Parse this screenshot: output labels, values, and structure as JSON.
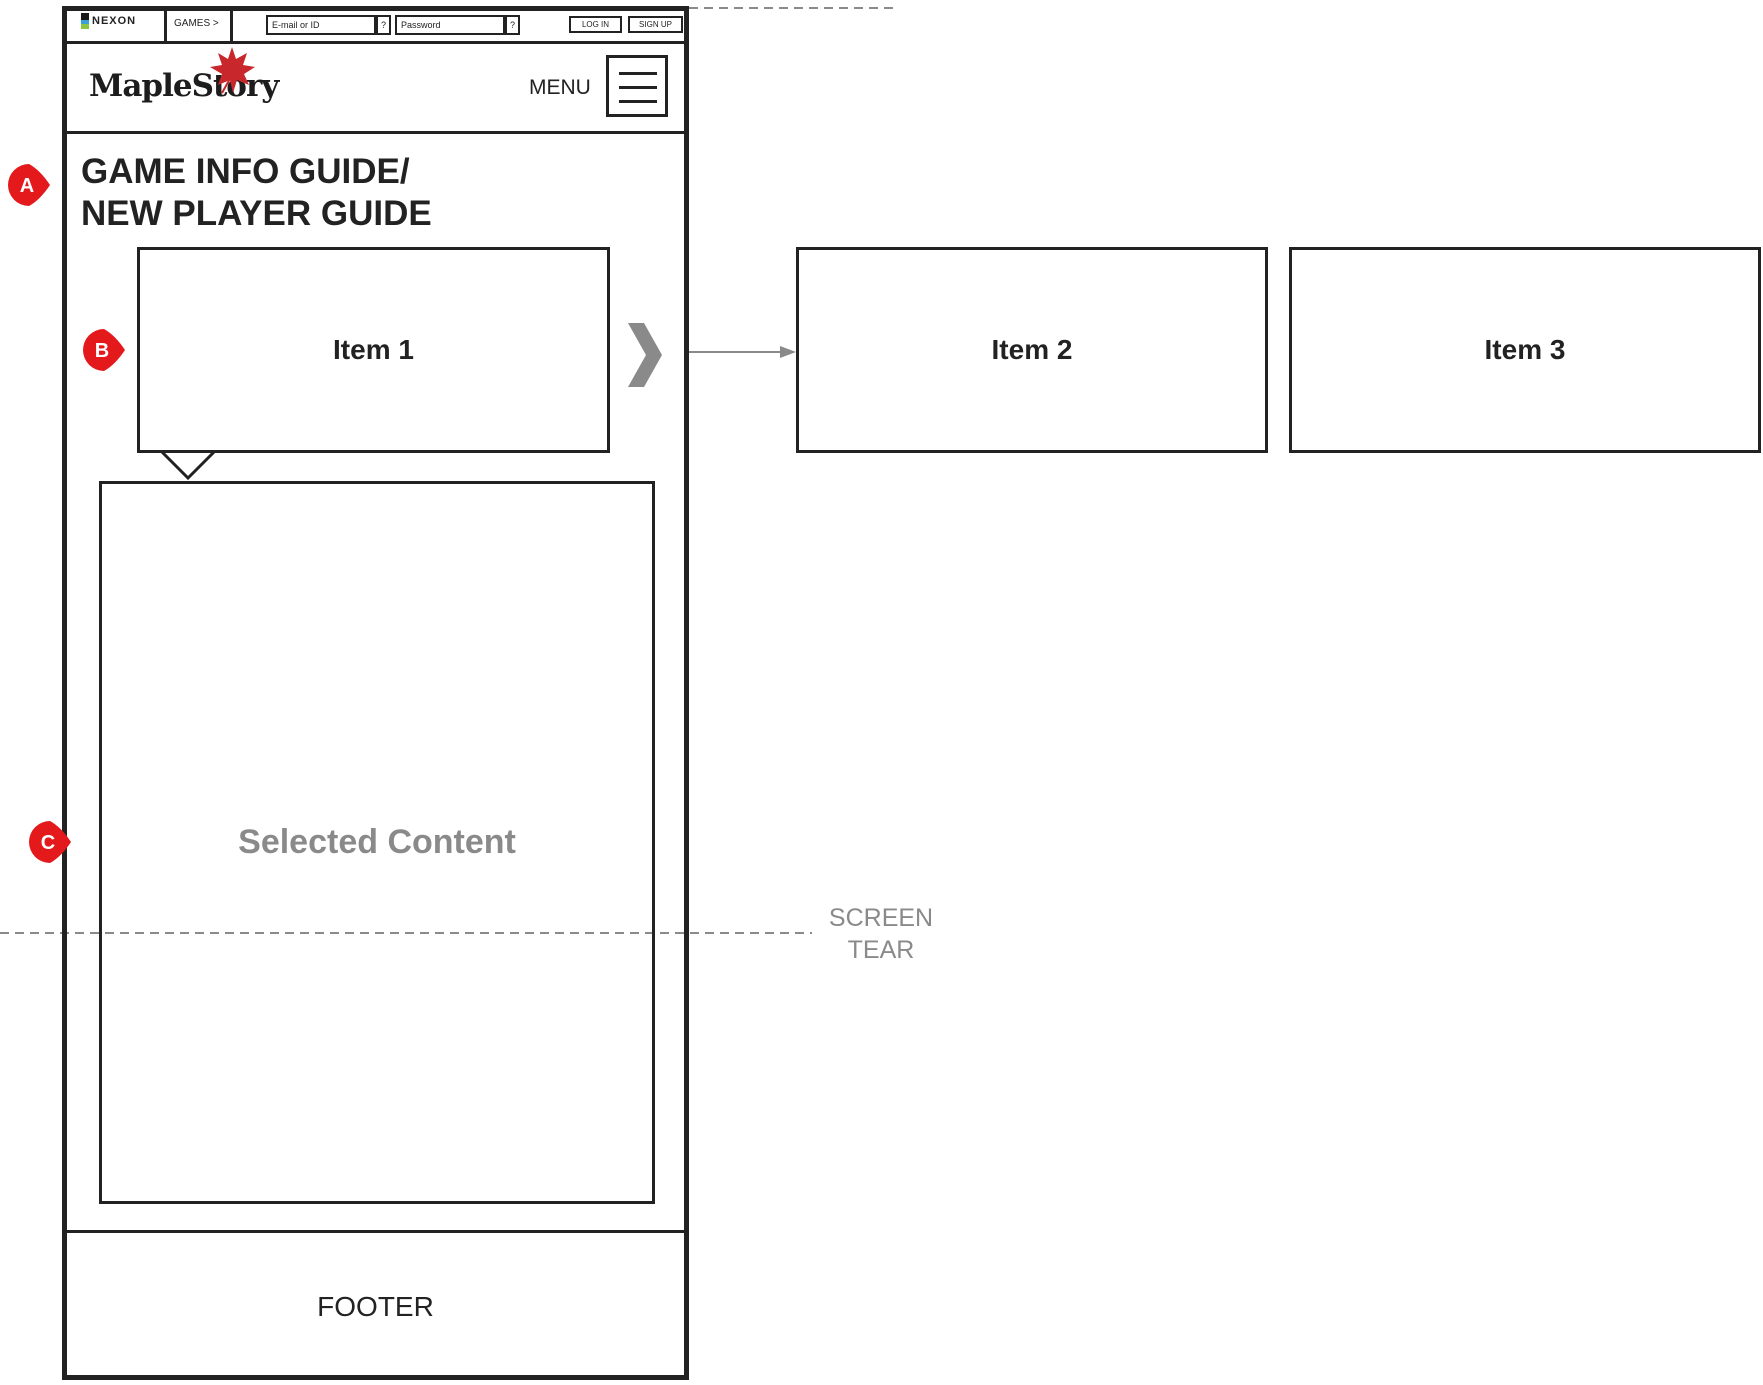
{
  "topbar": {
    "nexon_logo": "NEXON",
    "games_link": "GAMES >",
    "email_placeholder": "E-mail or ID",
    "email_help": "?",
    "password_placeholder": "Password",
    "password_help": "?",
    "login_label": "LOG IN",
    "signup_label": "SIGN UP"
  },
  "header": {
    "brand": "MapleStory",
    "menu_label": "MENU"
  },
  "main": {
    "title_line1": "GAME INFO GUIDE/",
    "title_line2": "NEW PLAYER GUIDE",
    "carousel_items": [
      "Item 1",
      "Item 2",
      "Item 3"
    ],
    "selected_content": "Selected Content"
  },
  "footer": {
    "label": "FOOTER"
  },
  "annotations": {
    "marker_a": "A",
    "marker_b": "B",
    "marker_c": "C",
    "screen_tear_line1": "SCREEN",
    "screen_tear_line2": "TEAR"
  },
  "colors": {
    "marker_red": "#e3191c",
    "wire_gray": "#8a8a8a",
    "frame": "#222222",
    "leaf_red": "#c8282c"
  }
}
